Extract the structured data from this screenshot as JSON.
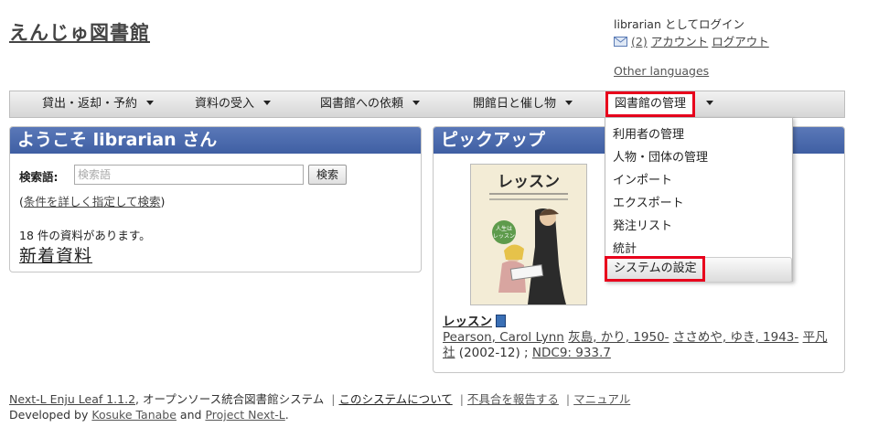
{
  "header": {
    "site_title": "えんじゅ図書館",
    "login_text": "librarian としてログイン",
    "mail_count": "(2)",
    "account_link": "アカウント",
    "logout_link": "ログアウト",
    "other_languages": "Other languages"
  },
  "nav": {
    "items": [
      {
        "label": "貸出・返却・予約"
      },
      {
        "label": "資料の受入"
      },
      {
        "label": "図書館への依頼"
      },
      {
        "label": "開館日と催し物"
      },
      {
        "label": "図書館の管理"
      }
    ]
  },
  "dropdown": {
    "items": [
      {
        "label": "利用者の管理"
      },
      {
        "label": "人物・団体の管理"
      },
      {
        "label": "インポート"
      },
      {
        "label": "エクスポート"
      },
      {
        "label": "発注リスト"
      },
      {
        "label": "統計"
      },
      {
        "label": "システムの設定"
      }
    ]
  },
  "welcome": {
    "heading": "ようこそ librarian さん",
    "search_label": "検索語:",
    "search_placeholder": "検索語",
    "search_button": "検索",
    "detail_open": "(",
    "detail_link": "条件を詳しく指定して検索",
    "detail_close": ")",
    "count_text": "18 件の資料があります。",
    "new_items": "新着資料"
  },
  "pickup": {
    "heading": "ピックアップ",
    "cover_title": "レッスン",
    "cover_badge": "人生は\nレッスン",
    "book_title": "レッスン",
    "authors": [
      "Pearson, Carol Lynn",
      "灰島, かり, 1950-",
      "ささめや, ゆき, 1943-"
    ],
    "publisher": "平凡社",
    "year": "(2002-12)",
    "separator": ";",
    "ndc": "NDC9: 933.7"
  },
  "footer": {
    "product": "Next-L Enju Leaf 1.1.2",
    "product_desc": ", オープンソース統合図書館システム",
    "about": "このシステムについて",
    "report": "不具合を報告する",
    "manual": "マニュアル",
    "dev_prefix": "Developed by",
    "dev_person": "Kosuke Tanabe",
    "dev_and": "and",
    "dev_project": "Project Next-L",
    "dev_end": "."
  },
  "colors": {
    "panel_header": "#4a69ad",
    "highlight_box": "#e8001c"
  }
}
